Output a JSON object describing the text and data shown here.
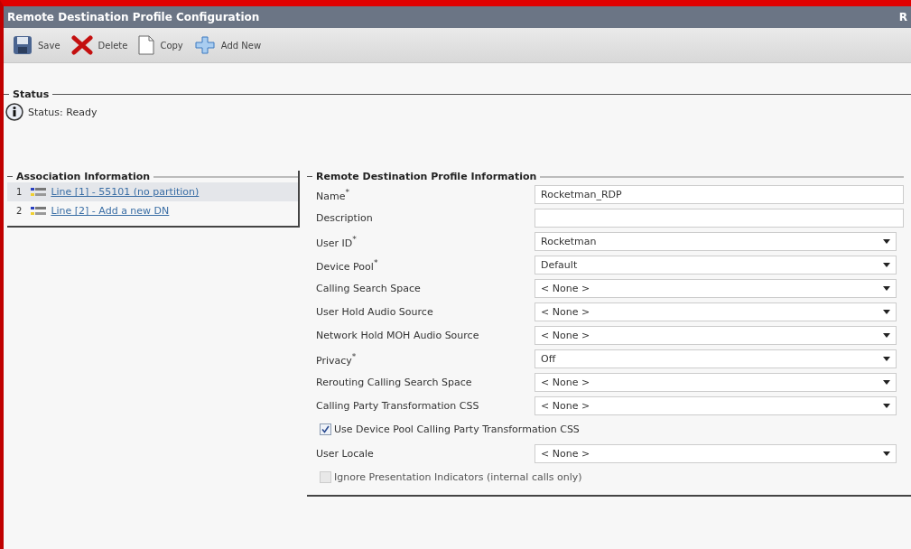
{
  "window": {
    "title": "Remote Destination Profile Configuration",
    "title_cut": "R"
  },
  "toolbar": [
    {
      "kind": "save",
      "label": "Save"
    },
    {
      "kind": "delete",
      "label": "Delete"
    },
    {
      "kind": "copy",
      "label": "Copy"
    },
    {
      "kind": "add",
      "label": "Add New"
    }
  ],
  "status": {
    "heading": "Status",
    "text": "Status: Ready"
  },
  "association": {
    "heading": "Association Information",
    "items": [
      {
        "number": "1",
        "label": "Line [1] - 55101 (no partition)",
        "selected": true
      },
      {
        "number": "2",
        "label": "Line [2] - Add a new DN",
        "selected": false
      }
    ]
  },
  "profile": {
    "heading": "Remote Destination Profile Information",
    "fields": [
      {
        "kind": "text",
        "label": "Name$^{*}$",
        "value": "Rocketman_RDP"
      },
      {
        "kind": "text",
        "label": "Description"
      },
      {
        "kind": "select",
        "label": "User ID$^{*}$",
        "value": "Rocketman"
      },
      {
        "kind": "select",
        "label": "Device Pool$^{*}$",
        "value": "Default"
      },
      {
        "kind": "select",
        "label": "Calling Search Space",
        "value": "< None >"
      },
      {
        "kind": "select",
        "label": "User Hold Audio Source",
        "value": "< None >"
      },
      {
        "kind": "select",
        "label": "Network Hold MOH Audio Source",
        "value": "< None >"
      },
      {
        "kind": "select",
        "label": "Privacy$^{*}$",
        "value": "Off"
      },
      {
        "kind": "select",
        "label": "Rerouting Calling Search Space",
        "value": "< None >"
      },
      {
        "kind": "select",
        "label": "Calling Party Transformation CSS",
        "value": "< None >"
      },
      {
        "kind": "checkbox",
        "label": "Use Device Pool Calling Party Transformation CSS",
        "checked": true,
        "disabled": false
      },
      {
        "kind": "select",
        "label": "User Locale",
        "value": "< None >"
      },
      {
        "kind": "checkbox",
        "label": "Ignore Presentation Indicators (internal calls only)",
        "checked": false,
        "disabled": true
      }
    ]
  }
}
